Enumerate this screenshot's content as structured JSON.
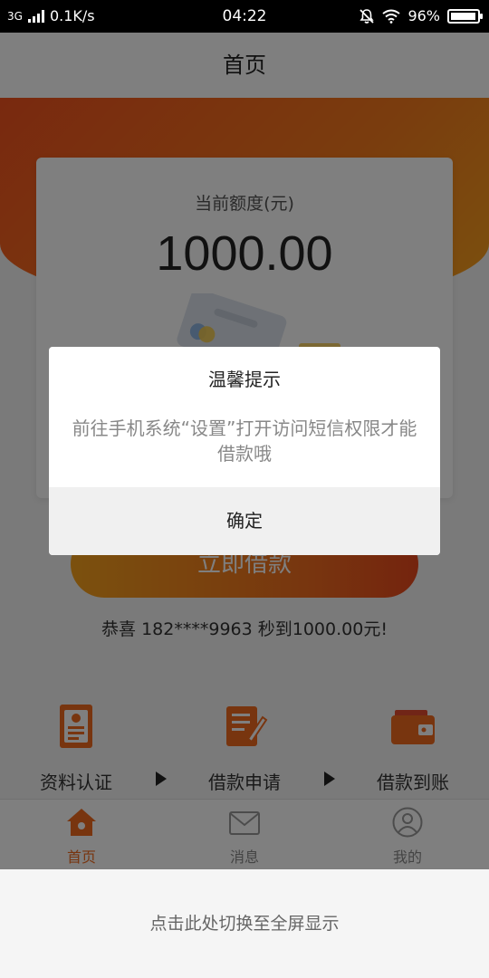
{
  "status_bar": {
    "network": "3G",
    "speed": "0.1K/s",
    "time": "04:22",
    "battery": "96%",
    "battery_level": 0.96
  },
  "header": {
    "title": "首页"
  },
  "credit": {
    "label": "当前额度(元)",
    "amount": "1000.00"
  },
  "borrow_button": "立即借款",
  "congrats": "恭喜 182****9963 秒到1000.00元!",
  "steps": [
    {
      "label": "资料认证",
      "icon": "id-card-icon"
    },
    {
      "label": "借款申请",
      "icon": "application-form-icon"
    },
    {
      "label": "借款到账",
      "icon": "wallet-icon"
    }
  ],
  "tabbar": [
    {
      "label": "首页",
      "icon": "home-icon",
      "active": true
    },
    {
      "label": "消息",
      "icon": "envelope-icon",
      "active": false
    },
    {
      "label": "我的",
      "icon": "user-avatar-icon",
      "active": false
    }
  ],
  "dialog": {
    "title": "温馨提示",
    "message": "前往手机系统“设置”打开访问短信权限才能借款哦",
    "confirm": "确定"
  },
  "fullscreen_hint": "点击此处切换至全屏显示",
  "colors": {
    "accent": "#f06a1e",
    "hero_gradient_start": "#f3521f",
    "hero_gradient_end": "#f7a31d",
    "overlay": "rgba(0,0,0,0.5)"
  }
}
